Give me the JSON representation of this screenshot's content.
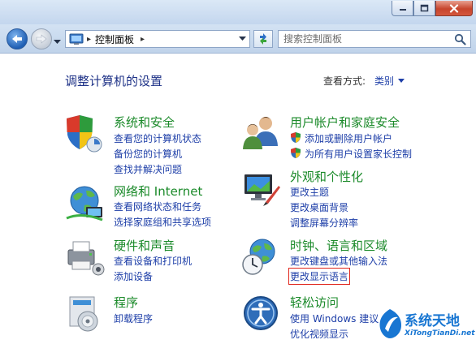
{
  "window": {
    "icons": {
      "minimize": "minimize-icon",
      "maximize": "maximize-icon",
      "close": "close-icon"
    }
  },
  "nav": {
    "breadcrumb": "控制面板",
    "search_placeholder": "搜索控制面板"
  },
  "header": {
    "title": "调整计算机的设置",
    "view_by_label": "查看方式:",
    "view_by_value": "类别"
  },
  "categories": [
    {
      "name": "系统和安全",
      "links": [
        "查看您的计算机状态",
        "备份您的计算机",
        "查找并解决问题"
      ]
    },
    {
      "name": "网络和 Internet",
      "links": [
        "查看网络状态和任务",
        "选择家庭组和共享选项"
      ]
    },
    {
      "name": "硬件和声音",
      "links": [
        "查看设备和打印机",
        "添加设备"
      ]
    },
    {
      "name": "程序",
      "links": [
        "卸载程序"
      ]
    },
    {
      "name": "用户帐户和家庭安全",
      "links": [
        "添加或删除用户帐户",
        "为所有用户设置家长控制"
      ]
    },
    {
      "name": "外观和个性化",
      "links": [
        "更改主题",
        "更改桌面背景",
        "调整屏幕分辨率"
      ]
    },
    {
      "name": "时钟、语言和区域",
      "links": [
        "更改键盘或其他输入法",
        "更改显示语言"
      ]
    },
    {
      "name": "轻松访问",
      "links": [
        "使用 Windows 建议",
        "优化视频显示"
      ]
    }
  ],
  "watermark": {
    "title": "系统天地",
    "site": "XiTongTianDi.net"
  },
  "colors": {
    "category_name": "#1b8a2a",
    "link": "#1e3fa8",
    "title": "#1e3287",
    "highlight_box": "#e0251b"
  }
}
